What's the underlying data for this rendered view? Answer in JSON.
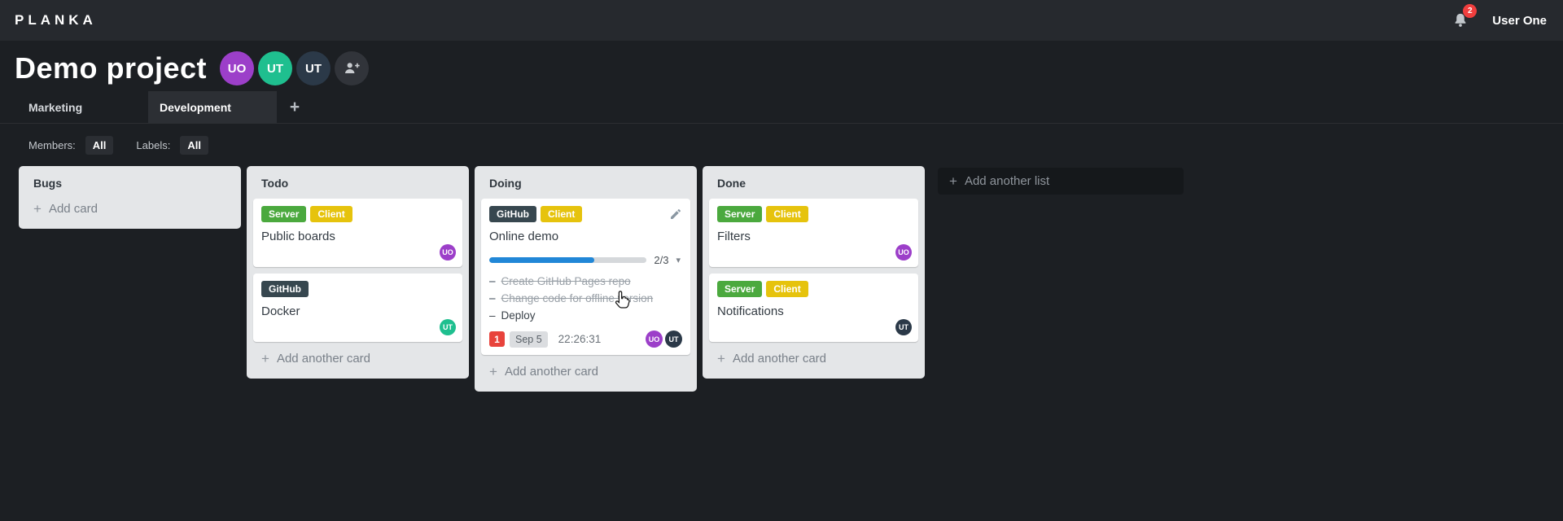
{
  "colors": {
    "appbar_bg": "#26292e",
    "body_bg": "#1c1f23",
    "list_bg": "#e4e6e8",
    "label_green": "#4ba93e",
    "label_yellow": "#e6c30d",
    "label_navy": "#37474f",
    "progress_blue": "#2187d7",
    "notification_red": "#e8433c",
    "avatar_purple": "#9c3fc9",
    "avatar_teal": "#1fbf8f",
    "avatar_navy": "#2b3948"
  },
  "icons": {
    "plus": "+",
    "caret_down": "▾",
    "dash": "–"
  },
  "appbar": {
    "logo": "PLANKA",
    "notification_count": "2",
    "user_name": "User One"
  },
  "project": {
    "title": "Demo project",
    "members": [
      {
        "initials": "UO",
        "color": "#9c3fc9"
      },
      {
        "initials": "UT",
        "color": "#1fbf8f"
      },
      {
        "initials": "UT",
        "color": "#2b3948"
      }
    ]
  },
  "tabs": {
    "items": [
      {
        "label": "Marketing",
        "selected": false
      },
      {
        "label": "Development",
        "selected": true
      }
    ]
  },
  "filters": {
    "members_label": "Members:",
    "members_value": "All",
    "labels_label": "Labels:",
    "labels_value": "All"
  },
  "board": {
    "add_list_label": "Add another list",
    "lists": [
      {
        "name": "Bugs",
        "add_card_label": "Add card",
        "cards": []
      },
      {
        "name": "Todo",
        "add_card_label": "Add another card",
        "cards": [
          {
            "title": "Public boards",
            "labels": [
              {
                "text": "Server"
              },
              {
                "text": "Client"
              }
            ],
            "assignee": {
              "initials": "UO"
            }
          },
          {
            "title": "Docker",
            "labels": [
              {
                "text": "GitHub"
              }
            ],
            "assignee": {
              "initials": "UT"
            }
          }
        ]
      },
      {
        "name": "Doing",
        "add_card_label": "Add another card",
        "cards": [
          {
            "title": "Online demo",
            "labels": [
              {
                "text": "GitHub"
              },
              {
                "text": "Client"
              }
            ],
            "checklist": {
              "completed": 2,
              "total": 3,
              "progress_label": "2/3",
              "tasks": [
                {
                  "text": "Create GitHub Pages repo",
                  "done": true
                },
                {
                  "text": "Change code for offline version",
                  "done": true
                },
                {
                  "text": "Deploy",
                  "done": false
                }
              ]
            },
            "notification_count": "1",
            "due_date": "Sep 5",
            "timer": "22:26:31",
            "assignees": [
              {
                "initials": "UO"
              },
              {
                "initials": "UT"
              }
            ]
          }
        ]
      },
      {
        "name": "Done",
        "add_card_label": "Add another card",
        "cards": [
          {
            "title": "Filters",
            "labels": [
              {
                "text": "Server"
              },
              {
                "text": "Client"
              }
            ],
            "assignee": {
              "initials": "UO"
            }
          },
          {
            "title": "Notifications",
            "labels": [
              {
                "text": "Server"
              },
              {
                "text": "Client"
              }
            ],
            "assignee": {
              "initials": "UT"
            }
          }
        ]
      }
    ]
  }
}
